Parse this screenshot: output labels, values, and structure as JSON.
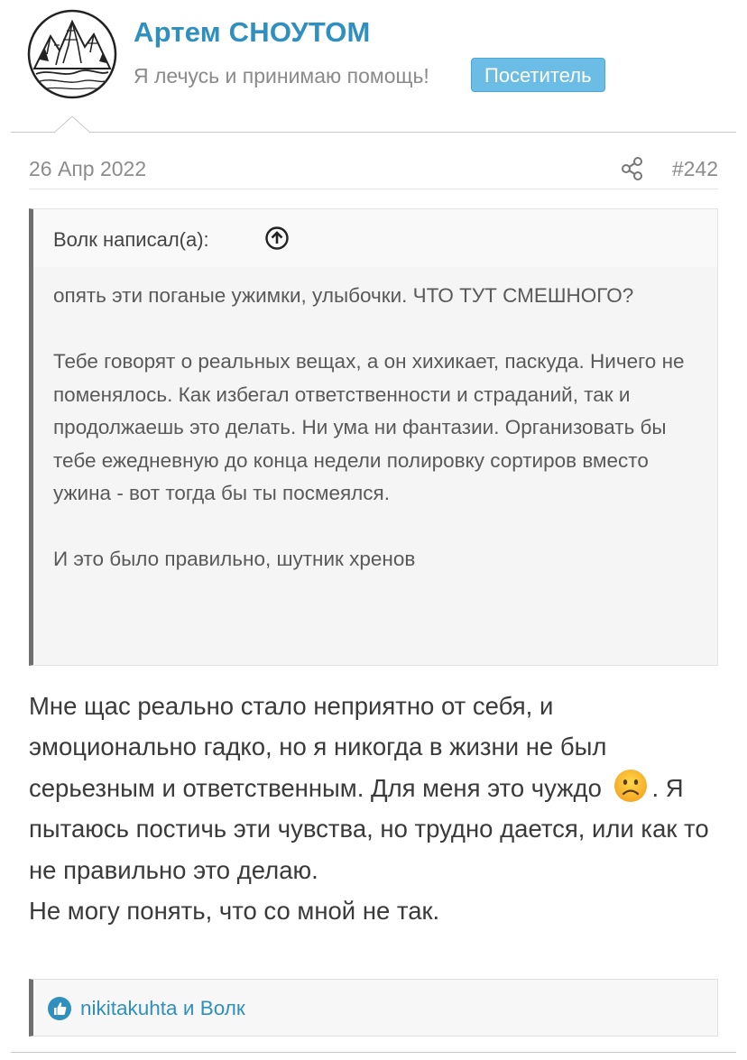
{
  "user": {
    "name": "Артем СНОУТОМ",
    "title": "Я лечусь и принимаю помощь!",
    "badge": "Посетитель"
  },
  "post": {
    "date": "26 Апр 2022",
    "number": "#242"
  },
  "quote": {
    "author": "Волк написал(а):",
    "paragraphs": [
      "опять эти поганые ужимки, улыбочки. ЧТО ТУТ СМЕШНОГО?",
      "Тебе говорят о реальных вещах, а он хихикает, паскуда. Ничего не поменялось. Как избегал ответственности и страданий, так и продолжаешь это делать. Ни ума ни фантазии. Организовать бы тебе ежедневную до конца недели полировку сортиров вместо ужина - вот тогда бы ты посмеялся.",
      "И это было правильно, шутник хренов"
    ]
  },
  "message": {
    "part1": "Мне щас реально стало неприятно от себя, и эмоционально гадко, но я никогда в жизни не был серьезным и ответственным. Для меня это чуждо",
    "part2": ". Я пытаюсь постичь эти чувства, но трудно дается, или как то не правильно это делаю.",
    "part3": "Не могу понять, что со мной не так."
  },
  "reactions": {
    "user1": "nikitakuhta",
    "separator": "и",
    "user2": "Волк"
  },
  "icons": {
    "share": "share-icon",
    "quote_up": "arrow-up-circle-icon",
    "emoji": "frowning-face-icon",
    "like": "thumbs-up-icon"
  },
  "colors": {
    "accent": "#2f8fbe",
    "badge": "#6bbde6",
    "quote_border": "#6e6e6e"
  }
}
